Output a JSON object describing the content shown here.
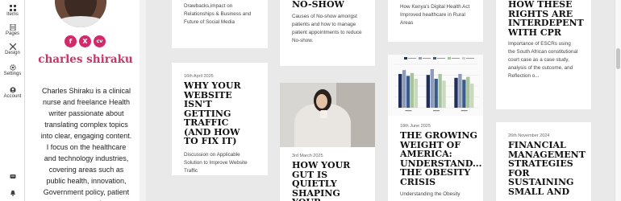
{
  "rail": {
    "items": [
      {
        "label": "Items"
      },
      {
        "label": "Pages"
      },
      {
        "label": "Design"
      },
      {
        "label": "Settings"
      },
      {
        "label": "Account"
      }
    ]
  },
  "profile": {
    "name": "charles shiraku",
    "socials": [
      "f",
      "X",
      "cv"
    ],
    "bio": "Charles Shiraku is a clinical nurse and freelance Health writer passionate about translating complex topics into clear, engaging content. I focus on the healthcare and technology industries, covering areas such as public health, innovation, Government policy, patient care, and"
  },
  "cards": {
    "c1": {
      "text": "Drawbacks,impact on Relationships & Business and Future of Social Media"
    },
    "c2": {
      "date": "16th April 2025",
      "title": "WHY YOUR WEBSITE ISN'T GETTING TRAFFIC (AND HOW TO FIX IT)",
      "text": "Discussion on Applicable Solution to Improve Website Traffic"
    },
    "c3": {
      "title": "NO-SHOW",
      "text": "Causes of No-show amongst patients and how to manage patient appointments to reduce No-show."
    },
    "c4": {
      "date": "3rd March 2025",
      "title": "HOW YOUR GUT IS QUIETLY SHAPING YOUR"
    },
    "c5": {
      "text": "How Kenya's Digital Health Act Improved healthcare in Rural Areas"
    },
    "c6": {
      "date": "18th June 2025",
      "title": "THE GROWING WEIGHT OF AMERICA: UNDERSTAND... THE OBESITY CRISIS",
      "text": "Understanding the Obesity"
    },
    "c7": {
      "title": "HOW THESE RIGHTS ARE INTERDEPENT WITH CPR",
      "text": "Importance of ESCRs using the South African constitutional court case as a case study, analysis of the outcome, and Reflection o..."
    },
    "c8": {
      "date": "26th November 2024",
      "title": "FINANCIAL MANAGEMENT STRATEGIES FOR SUSTAINING SMALL AND"
    }
  },
  "colors": {
    "accent": "#c93569",
    "social": "#d1296a"
  },
  "chart_data": {
    "type": "bar",
    "categories": [
      "Year 1",
      "Year 2",
      "Year 3"
    ],
    "series": [
      {
        "values": [
          70,
          68,
          62
        ]
      },
      {
        "values": [
          78,
          80,
          70
        ]
      },
      {
        "values": [
          66,
          60,
          58
        ]
      },
      {
        "values": [
          72,
          70,
          64
        ]
      },
      {
        "values": [
          60,
          56,
          50
        ]
      }
    ],
    "ylim": [
      0,
      90
    ],
    "legend": "top"
  }
}
